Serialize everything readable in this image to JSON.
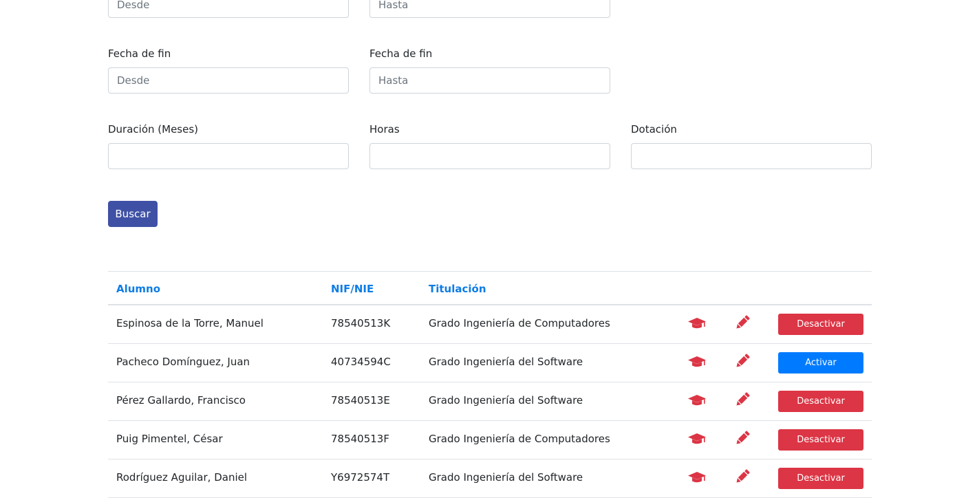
{
  "filters": {
    "row0": {
      "from_placeholder": "Desde",
      "to_placeholder": "Hasta"
    },
    "row1": {
      "from_label": "Fecha de fin",
      "to_label": "Fecha de fin",
      "from_placeholder": "Desde",
      "to_placeholder": "Hasta"
    },
    "row2": {
      "duracion_label": "Duración (Meses)",
      "horas_label": "Horas",
      "dotacion_label": "Dotación"
    },
    "search_button": "Buscar"
  },
  "table": {
    "headers": {
      "alumno": "Alumno",
      "nif": "NIF/NIE",
      "titulacion": "Titulación"
    },
    "rows": [
      {
        "alumno": "Espinosa de la Torre, Manuel",
        "nif": "78540513K",
        "titulacion": "Grado Ingeniería de Computadores",
        "action": "Desactivar"
      },
      {
        "alumno": "Pacheco Domínguez, Juan",
        "nif": "40734594C",
        "titulacion": "Grado Ingeniería del Software",
        "action": "Activar"
      },
      {
        "alumno": "Pérez Gallardo, Francisco",
        "nif": "78540513E",
        "titulacion": "Grado Ingeniería del Software",
        "action": "Desactivar"
      },
      {
        "alumno": "Puig Pimentel, César",
        "nif": "78540513F",
        "titulacion": "Grado Ingeniería de Computadores",
        "action": "Desactivar"
      },
      {
        "alumno": "Rodríguez Aguilar, Daniel",
        "nif": "Y6972574T",
        "titulacion": "Grado Ingeniería del Software",
        "action": "Desactivar"
      }
    ],
    "icons": {
      "degree": "graduation-cap-icon",
      "edit": "pencil-icon"
    }
  },
  "colors": {
    "primary_button": "#3f51a5",
    "header_link": "#0d7ce4",
    "icon_red": "#dc3545",
    "deactivate": "#dc3545",
    "activate": "#007bff"
  }
}
